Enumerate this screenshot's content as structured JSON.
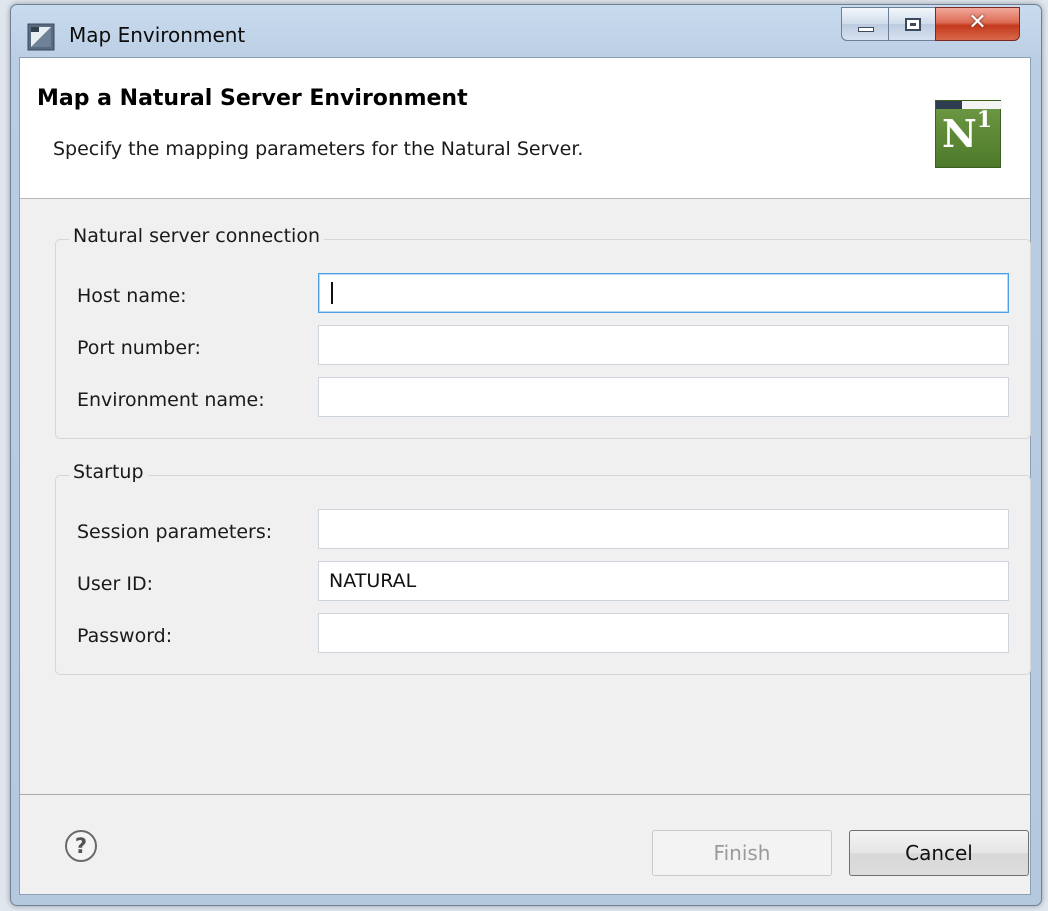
{
  "window": {
    "title": "Map Environment",
    "close_glyph": "✕"
  },
  "banner": {
    "title": "Map a Natural Server Environment",
    "description": "Specify the mapping parameters for the Natural Server.",
    "logo_letter": "N",
    "logo_superscript": "1"
  },
  "connection_group": {
    "legend": "Natural server connection",
    "host_label": "Host name:",
    "host_value": "",
    "port_label": "Port number:",
    "port_value": "",
    "env_label": "Environment name:",
    "env_value": ""
  },
  "startup_group": {
    "legend": "Startup",
    "session_label": "Session parameters:",
    "session_value": "",
    "userid_label": "User ID:",
    "userid_value": "NATURAL",
    "password_label": "Password:",
    "password_value": ""
  },
  "footer": {
    "help_glyph": "?",
    "finish_label": "Finish",
    "cancel_label": "Cancel"
  },
  "colors": {
    "focus_border": "#4f9fe3",
    "logo_green": "#5b8a34",
    "close_red": "#c4391c"
  },
  "icons": {
    "app": "window-app-icon",
    "help": "help-icon",
    "logo": "natural-n1-logo"
  }
}
